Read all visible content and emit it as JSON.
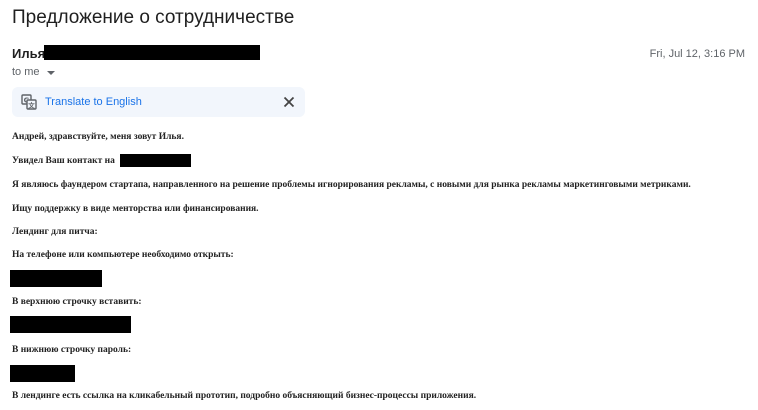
{
  "subject": "Предложение о сотрудничестве",
  "sender": {
    "name": "Илья"
  },
  "recipient": {
    "label": "to me"
  },
  "date": "Fri, Jul 12, 3:16 PM",
  "translate": {
    "label": "Translate to English"
  },
  "body": {
    "greeting": "Андрей, здравствуйте, меня зовут Илья.",
    "contact": "Увидел Ваш контакт на",
    "intro": "Я являюсь фаундером стартапа, направленного на решение проблемы игнорирования рекламы, с новыми для рынка рекламы маркетинговыми метриками.",
    "ask": "Ищу поддержку в виде менторства или финансирования.",
    "landing": "Лендинг для питча:",
    "open": "На телефоне или компьютере необходимо открыть:",
    "top_row": "В верхнюю строчку вставить:",
    "bottom_row": "В нижнюю строчку пароль:",
    "prototype": "В лендинге есть ссылка на кликабельный прототип, подробно объясняющий бизнес-процессы приложения."
  },
  "icons": {
    "translate": "translate-icon",
    "close": "close-icon",
    "caret": "caret-down-icon"
  }
}
